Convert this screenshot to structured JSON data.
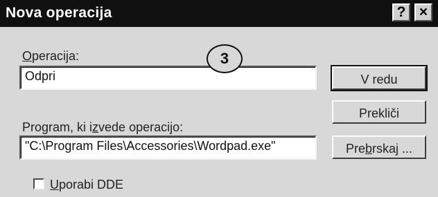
{
  "window": {
    "title": "Nova operacija",
    "help_label": "?",
    "close_label": "×"
  },
  "operation": {
    "label": "Operacija:",
    "value": "Odpri"
  },
  "program": {
    "label": "Program, ki izvede operacijo:",
    "value": "\"C:\\Program Files\\Accessories\\Wordpad.exe\""
  },
  "buttons": {
    "ok": "V redu",
    "cancel": "Prekliči",
    "browse": "Prebrskaj ..."
  },
  "dde": {
    "label": "Uporabi DDE",
    "checked": false
  },
  "annotation": {
    "number": "3"
  }
}
